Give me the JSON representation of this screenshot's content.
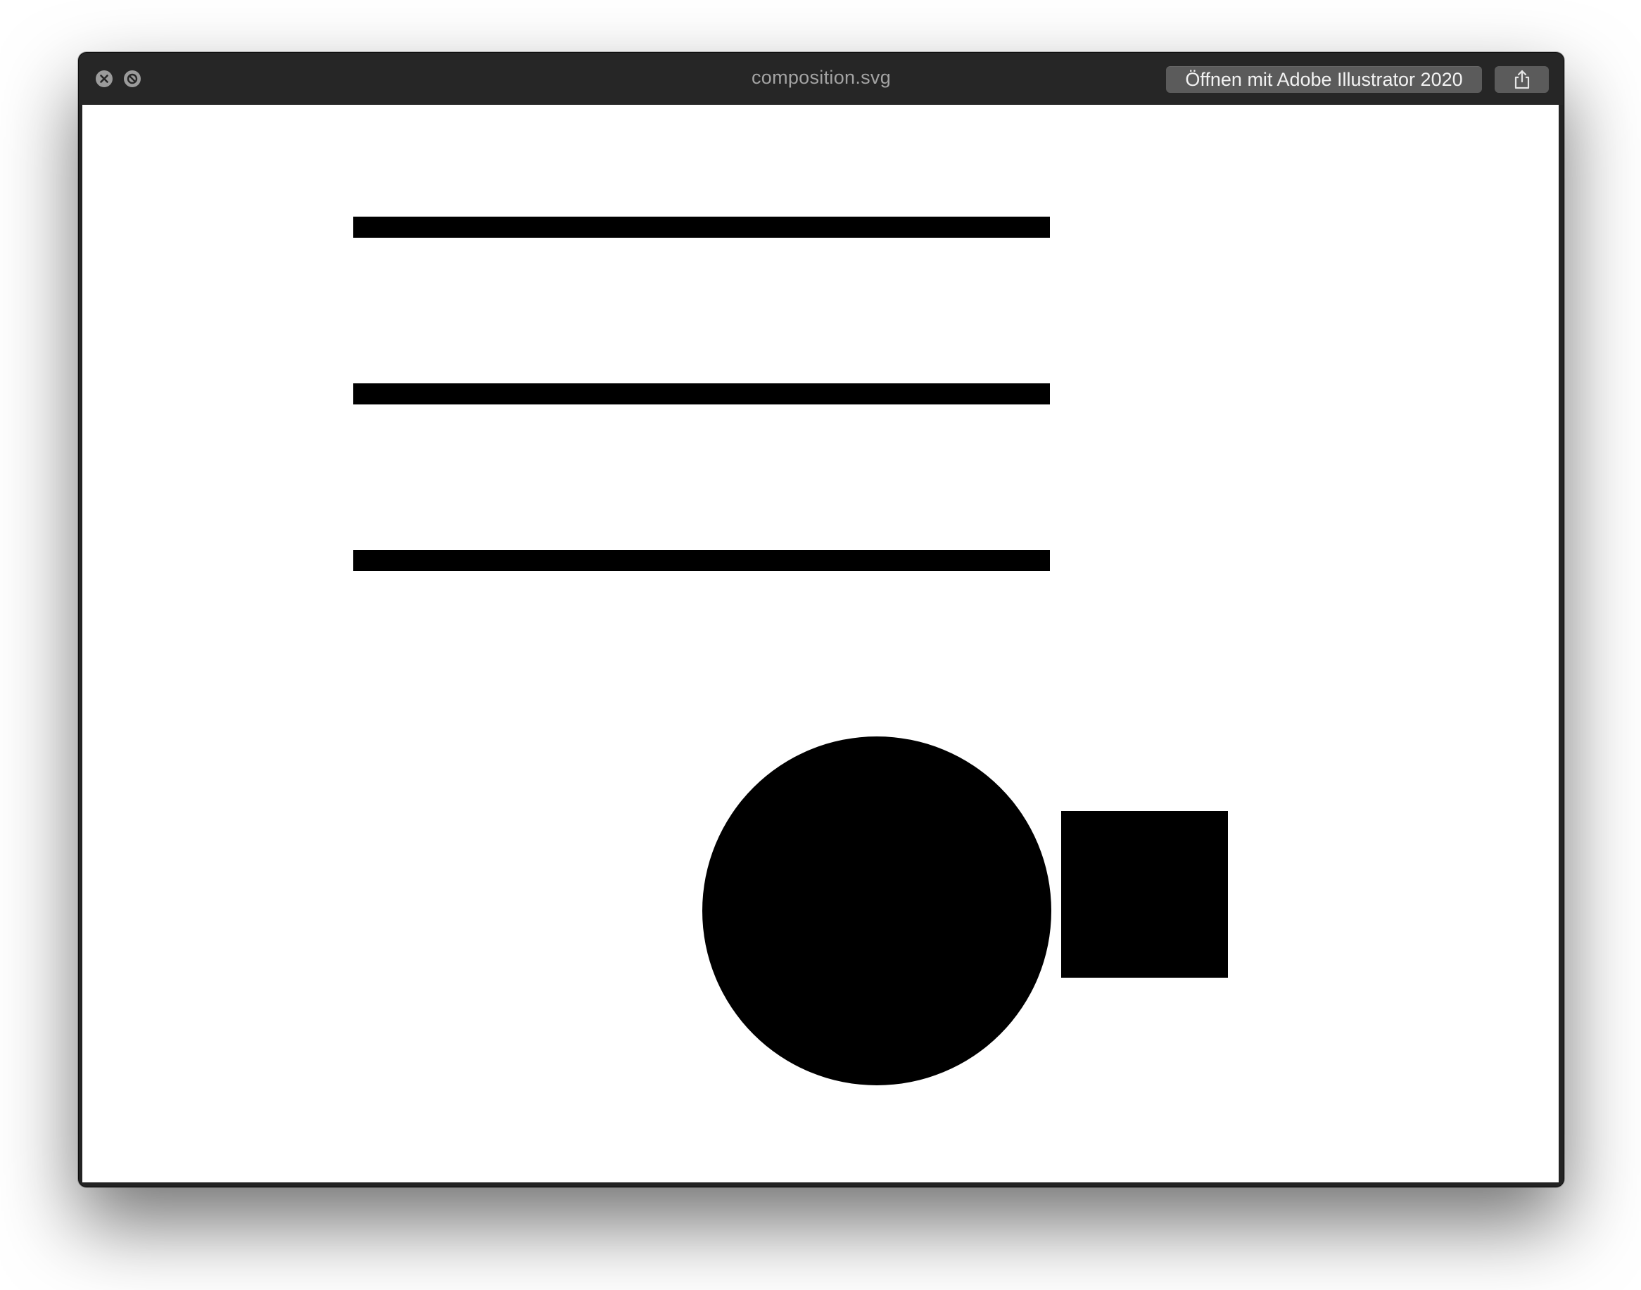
{
  "window": {
    "title": "composition.svg",
    "open_with_label": "Öffnen mit Adobe Illustrator 2020"
  },
  "icons": {
    "close": "close-icon",
    "minimize": "minimize-icon",
    "share": "share-icon"
  },
  "artwork": {
    "fill_color": "#000000",
    "background_color": "#ffffff",
    "shapes": [
      "bar",
      "bar",
      "bar",
      "circle",
      "square"
    ]
  }
}
